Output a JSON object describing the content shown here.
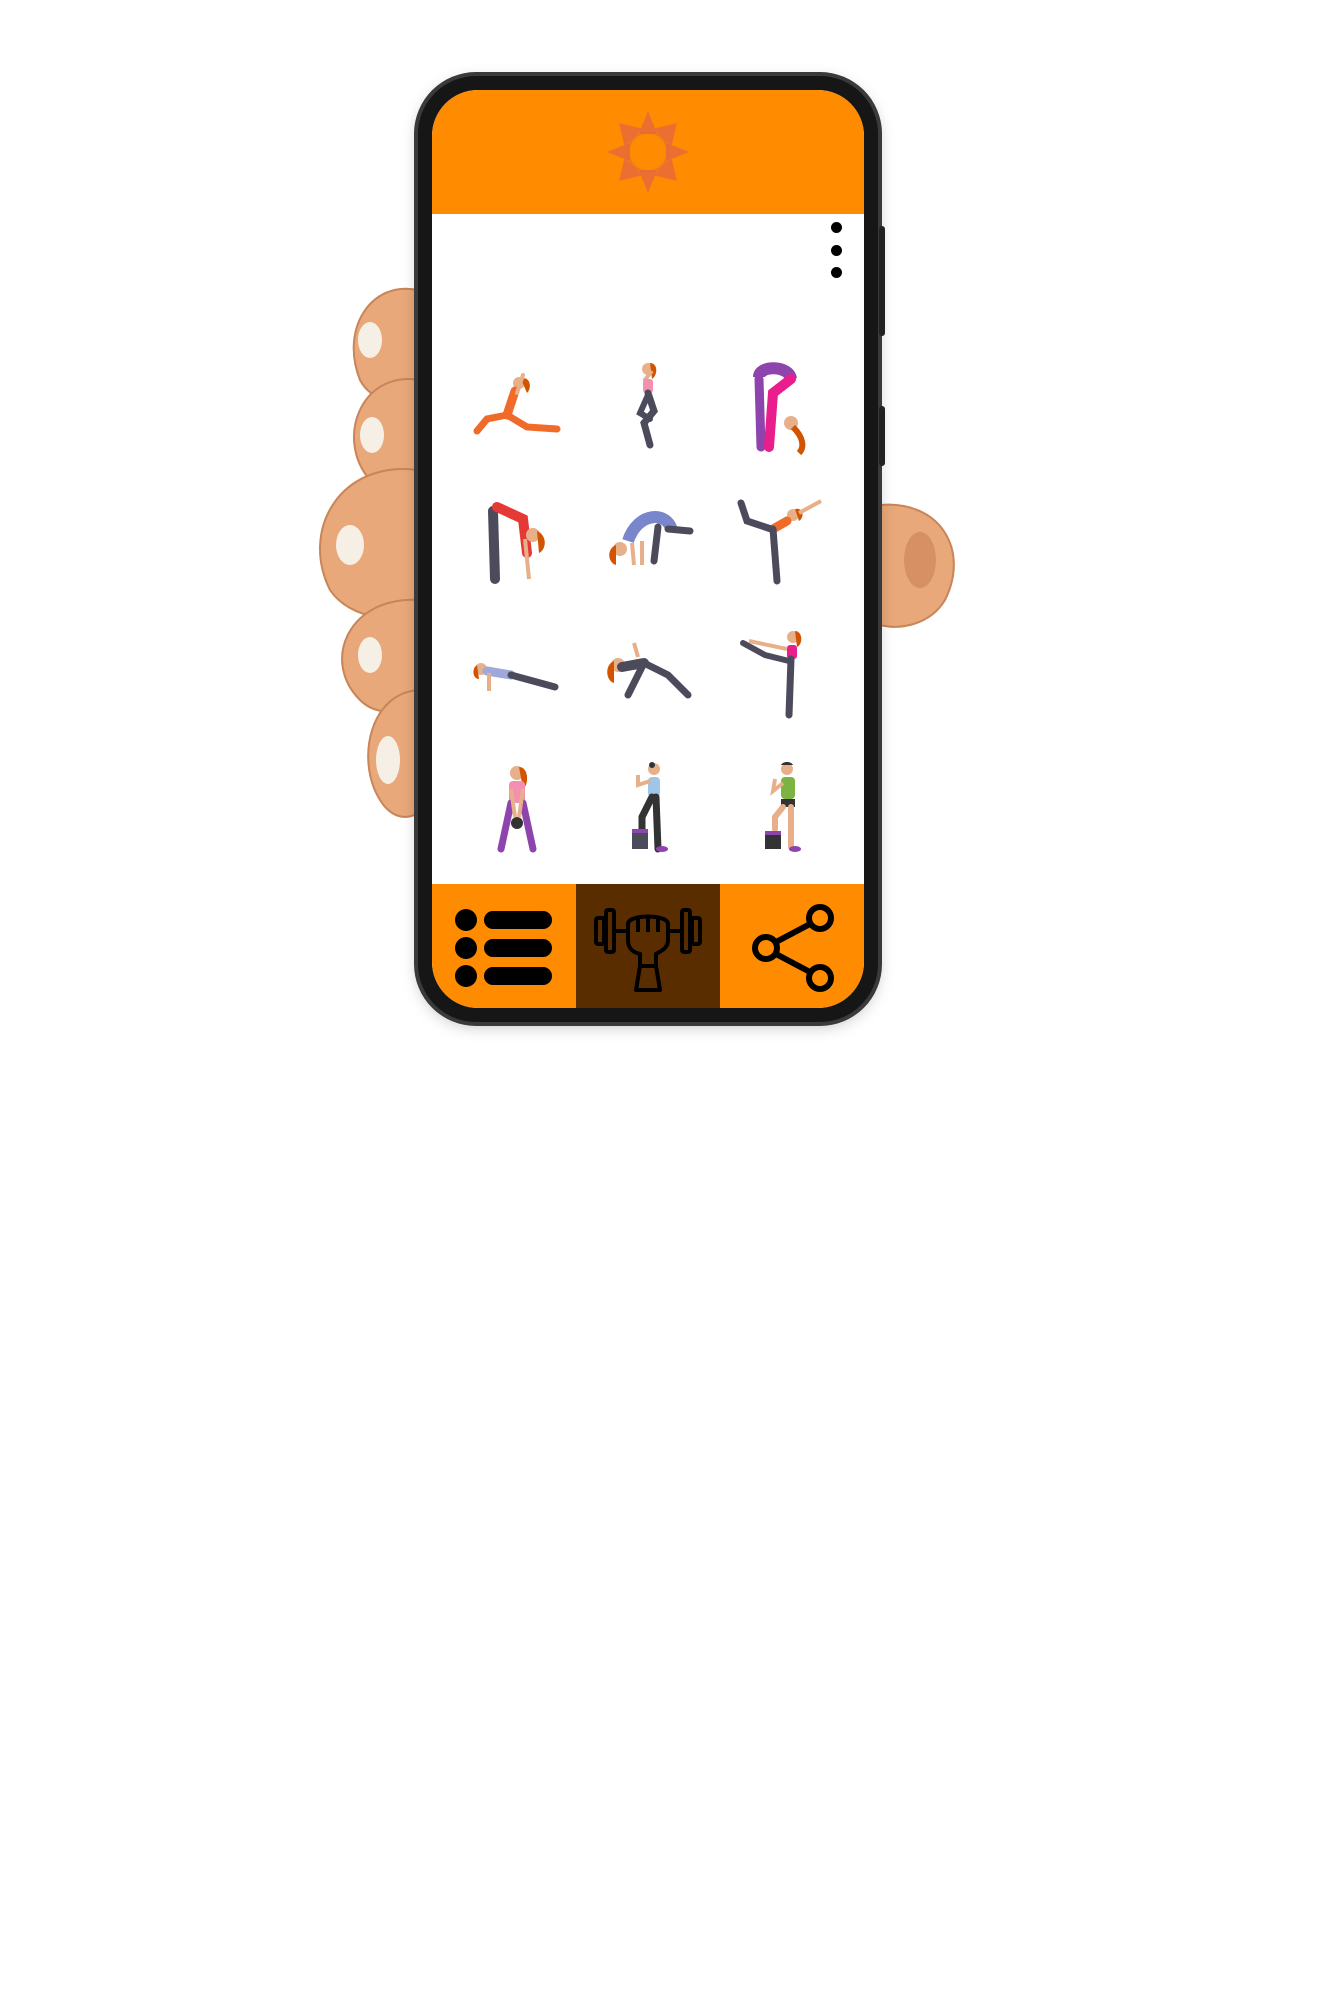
{
  "app": {
    "accent_color": "#ff8c00",
    "active_tab_color": "#5a2d00",
    "logo_icon": "star-flower-icon",
    "menu_icon": "kebab-menu-icon"
  },
  "poses": [
    {
      "name": "low-lunge",
      "top_color": "#f06a2a",
      "bottom_color": "#f06a2a"
    },
    {
      "name": "eagle",
      "top_color": "#f48fb1",
      "bottom_color": "#4b4b5c"
    },
    {
      "name": "forward-fold-wide",
      "top_color": "#e91e8c",
      "bottom_color": "#8e44ad"
    },
    {
      "name": "forward-fold",
      "top_color": "#e53935",
      "bottom_color": "#4b4b5c"
    },
    {
      "name": "crow",
      "top_color": "#7986cb",
      "bottom_color": "#4b4b5c"
    },
    {
      "name": "dancer",
      "top_color": "#f06a2a",
      "bottom_color": "#4b4b5c"
    },
    {
      "name": "plank",
      "top_color": "#9fa8da",
      "bottom_color": "#4b4b5c"
    },
    {
      "name": "side-angle",
      "top_color": "#4b4b5c",
      "bottom_color": "#4b4b5c"
    },
    {
      "name": "standing-leg-raise",
      "top_color": "#e91e8c",
      "bottom_color": "#4b4b5c"
    },
    {
      "name": "kettlebell-swing",
      "top_color": "#f48fb1",
      "bottom_color": "#8e44ad"
    },
    {
      "name": "step-up-woman",
      "top_color": "#9fc5e8",
      "bottom_color": "#333333"
    },
    {
      "name": "step-up-man",
      "top_color": "#7cb342",
      "bottom_color": "#333333"
    }
  ],
  "bottom_nav": [
    {
      "icon": "list-icon",
      "active": false
    },
    {
      "icon": "dumbbell-fist-icon",
      "active": true
    },
    {
      "icon": "share-icon",
      "active": false
    }
  ]
}
